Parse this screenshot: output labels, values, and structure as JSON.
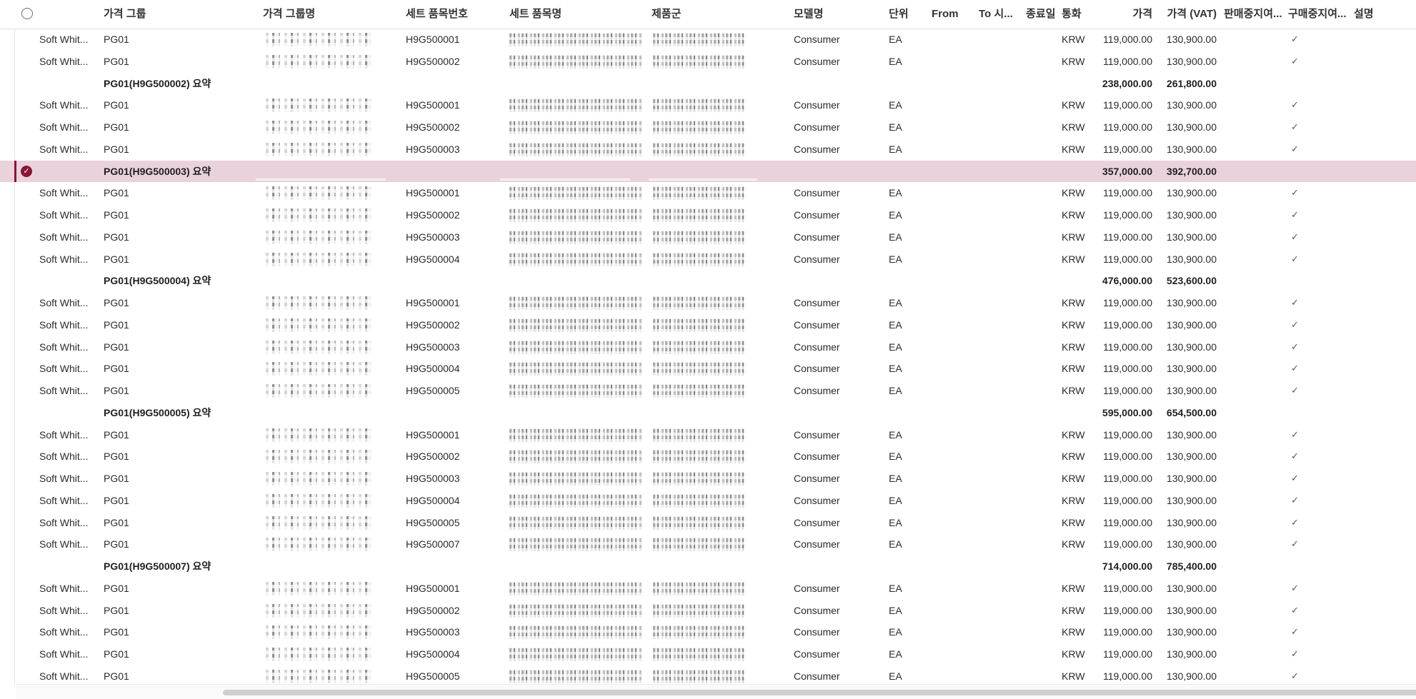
{
  "columns": {
    "group": "가격 그룹",
    "group_name": "가격 그룹명",
    "set_no": "세트 품목번호",
    "set_name": "세트 품목명",
    "product_group": "제품군",
    "model": "모델명",
    "unit": "단위",
    "from": "From",
    "to": "To 시...",
    "end_date": "종료일",
    "currency": "통화",
    "price": "가격",
    "price_vat": "가격 (VAT)",
    "sales_stop": "판매중지여...",
    "purchase_stop": "구매중지여...",
    "description": "설명"
  },
  "detail_row": {
    "first": "Soft Whit...",
    "group": "PG01",
    "model": "Consumer",
    "unit": "EA",
    "currency": "KRW",
    "price": "119,000.00",
    "price_vat": "130,900.00",
    "check": "✓"
  },
  "rows": [
    {
      "type": "detail",
      "set_no": "H9G500001"
    },
    {
      "type": "detail",
      "set_no": "H9G500002"
    },
    {
      "type": "summary",
      "label": "PG01(H9G500002) 요약",
      "price": "238,000.00",
      "price_vat": "261,800.00"
    },
    {
      "type": "detail",
      "set_no": "H9G500001"
    },
    {
      "type": "detail",
      "set_no": "H9G500002"
    },
    {
      "type": "detail",
      "set_no": "H9G500003"
    },
    {
      "type": "summary",
      "label": "PG01(H9G500003) 요약",
      "price": "357,000.00",
      "price_vat": "392,700.00",
      "selected": true
    },
    {
      "type": "detail",
      "set_no": "H9G500001"
    },
    {
      "type": "detail",
      "set_no": "H9G500002"
    },
    {
      "type": "detail",
      "set_no": "H9G500003"
    },
    {
      "type": "detail",
      "set_no": "H9G500004"
    },
    {
      "type": "summary",
      "label": "PG01(H9G500004) 요약",
      "price": "476,000.00",
      "price_vat": "523,600.00"
    },
    {
      "type": "detail",
      "set_no": "H9G500001"
    },
    {
      "type": "detail",
      "set_no": "H9G500002"
    },
    {
      "type": "detail",
      "set_no": "H9G500003"
    },
    {
      "type": "detail",
      "set_no": "H9G500004"
    },
    {
      "type": "detail",
      "set_no": "H9G500005"
    },
    {
      "type": "summary",
      "label": "PG01(H9G500005) 요약",
      "price": "595,000.00",
      "price_vat": "654,500.00"
    },
    {
      "type": "detail",
      "set_no": "H9G500001"
    },
    {
      "type": "detail",
      "set_no": "H9G500002"
    },
    {
      "type": "detail",
      "set_no": "H9G500003"
    },
    {
      "type": "detail",
      "set_no": "H9G500004"
    },
    {
      "type": "detail",
      "set_no": "H9G500005"
    },
    {
      "type": "detail",
      "set_no": "H9G500007"
    },
    {
      "type": "summary",
      "label": "PG01(H9G500007) 요약",
      "price": "714,000.00",
      "price_vat": "785,400.00"
    },
    {
      "type": "detail",
      "set_no": "H9G500001"
    },
    {
      "type": "detail",
      "set_no": "H9G500002"
    },
    {
      "type": "detail",
      "set_no": "H9G500003"
    },
    {
      "type": "detail",
      "set_no": "H9G500004"
    },
    {
      "type": "detail",
      "set_no": "H9G500005"
    }
  ]
}
